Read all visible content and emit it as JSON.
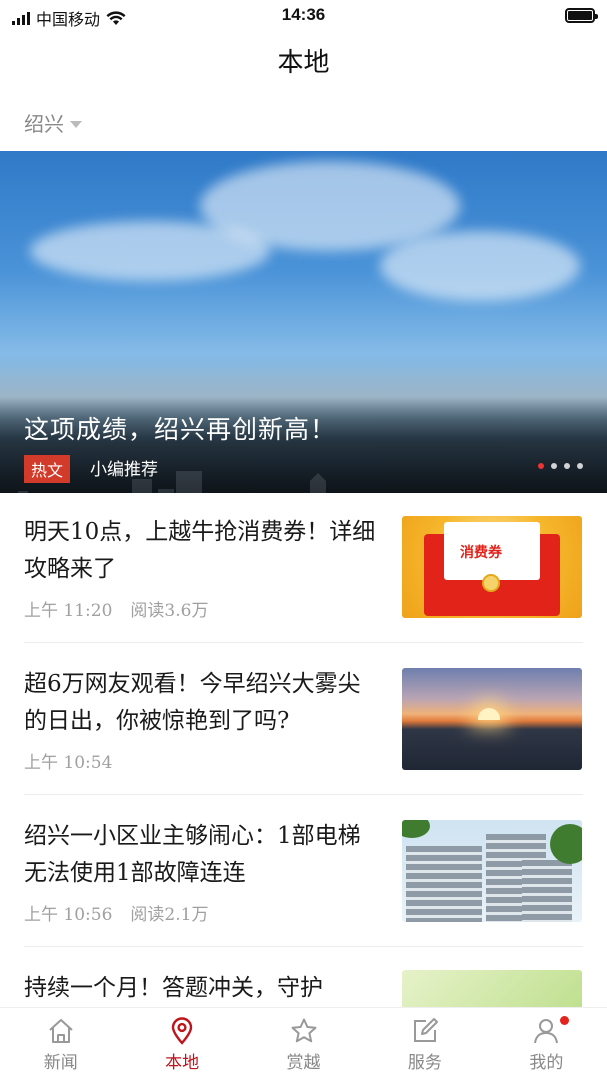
{
  "status_bar": {
    "carrier": "中国移动",
    "time": "14:36"
  },
  "header": {
    "title": "本地",
    "city": "绍兴"
  },
  "banner": {
    "title": "这项成绩，绍兴再创新高！",
    "tag": "热文",
    "subtitle": "小编推荐",
    "page_dots": 4,
    "active_dot": 0
  },
  "news": [
    {
      "title": "明天10点，上越牛抢消费券！详细攻略来了",
      "time": "上午 11:20",
      "reads": "阅读3.6万",
      "thumb_label": "消费券"
    },
    {
      "title": "超6万网友观看！今早绍兴大雾尖的日出，你被惊艳到了吗?",
      "time": "上午 10:54",
      "reads": ""
    },
    {
      "title": "绍兴一小区业主够闹心：1部电梯无法使用1部故障连连",
      "time": "上午 10:56",
      "reads": "阅读2.1万"
    },
    {
      "title": "持续一个月！答题冲关，守护"
    }
  ],
  "nav": [
    {
      "label": "新闻",
      "icon": "home-icon"
    },
    {
      "label": "本地",
      "icon": "location-pin-icon",
      "active": true
    },
    {
      "label": "赏越",
      "icon": "star-icon"
    },
    {
      "label": "服务",
      "icon": "edit-icon"
    },
    {
      "label": "我的",
      "icon": "user-icon",
      "badge": true
    }
  ],
  "colors": {
    "accent": "#c0141d",
    "tag_bg": "#d23a2a",
    "meta": "#a0a0a0"
  }
}
